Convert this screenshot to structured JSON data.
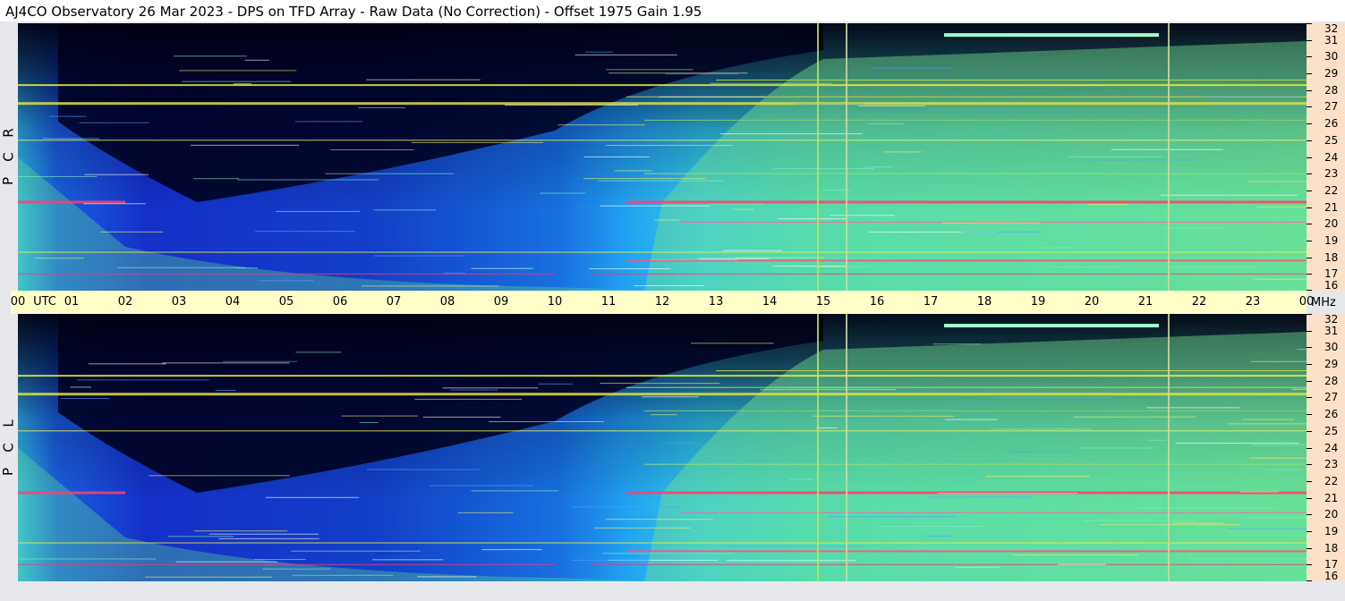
{
  "title": "AJ4CO Observatory  26 Mar 2023  -  DPS on TFD Array  -  Raw Data (No Correction)  -  Offset 1975  Gain 1.95",
  "chart_data": {
    "type": "heatmap",
    "title": "AJ4CO Observatory  26 Mar 2023  -  DPS on TFD Array  -  Raw Data (No Correction)  -  Offset 1975  Gain 1.95",
    "x_tick_labels": [
      "00",
      "01",
      "02",
      "03",
      "04",
      "05",
      "06",
      "07",
      "08",
      "09",
      "10",
      "11",
      "12",
      "13",
      "14",
      "15",
      "16",
      "17",
      "18",
      "19",
      "20",
      "21",
      "22",
      "23",
      "00"
    ],
    "x_unit": "UTC",
    "y_unit": "MHz",
    "y_ticks": [
      16,
      17,
      18,
      19,
      20,
      21,
      22,
      23,
      24,
      25,
      26,
      27,
      28,
      29,
      30,
      31,
      32
    ],
    "ylim": [
      16,
      32
    ],
    "xlim_hours": [
      0,
      24
    ],
    "panels": [
      {
        "label": [
          "R",
          "C",
          "P"
        ]
      },
      {
        "label": [
          "L",
          "C",
          "P"
        ]
      }
    ]
  },
  "colors": {
    "background_axis": "#ffffc8",
    "mhz_axis": "#fde0c8"
  }
}
